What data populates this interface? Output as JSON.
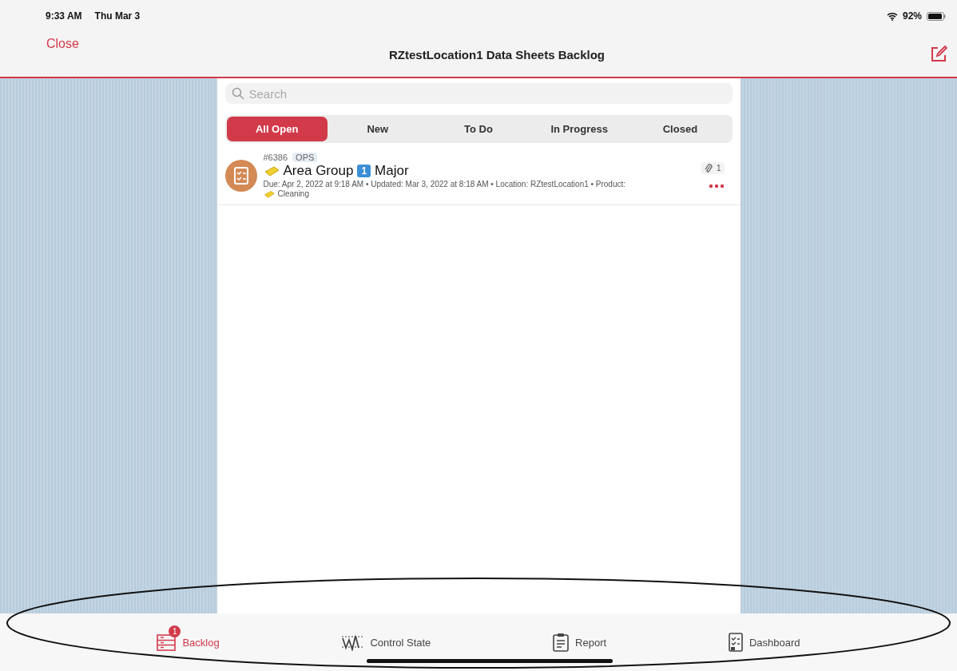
{
  "status_bar": {
    "time": "9:33 AM",
    "date": "Thu Mar 3",
    "battery": "92%"
  },
  "nav": {
    "close": "Close",
    "title": "RZtestLocation1 Data Sheets Backlog"
  },
  "search": {
    "placeholder": "Search"
  },
  "filters": [
    {
      "label": "All Open",
      "selected": true
    },
    {
      "label": "New",
      "selected": false
    },
    {
      "label": "To Do",
      "selected": false
    },
    {
      "label": "In Progress",
      "selected": false
    },
    {
      "label": "Closed",
      "selected": false
    }
  ],
  "items": [
    {
      "number": "#6386",
      "tag": "OPS",
      "group": "Area Group",
      "priority_number": "1",
      "priority": "Major",
      "attachments": "1",
      "details": "Due: Apr 2, 2022 at 9:18 AM • Updated: Mar 3, 2022 at 8:18 AM • Location: RZtestLocation1 • Product:",
      "product": "Cleaning"
    }
  ],
  "tab_bar": [
    {
      "label": "Backlog",
      "kind": "list",
      "badge": "1",
      "selected": true
    },
    {
      "label": "Control State",
      "kind": "chart",
      "selected": false
    },
    {
      "label": "Report",
      "kind": "clipboard",
      "selected": false
    },
    {
      "label": "Dashboard",
      "kind": "checklist",
      "selected": false
    }
  ]
}
